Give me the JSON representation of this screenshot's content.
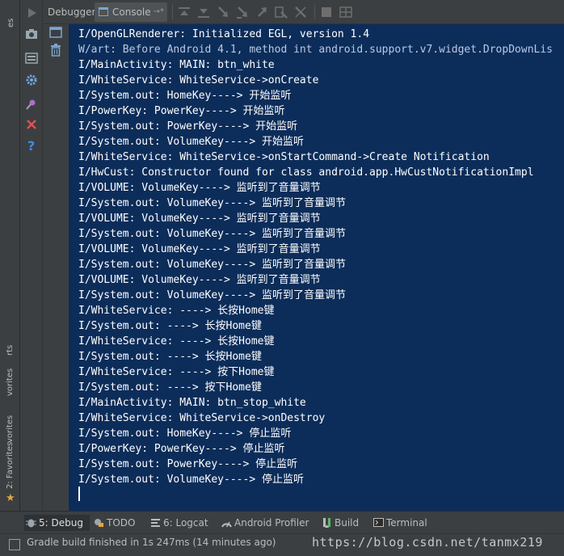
{
  "left_stripe": {
    "top_label": "es",
    "favorites_label": "2: Favorites",
    "favorites_cut": "vorites",
    "favorites_cut2": "vorites",
    "structure_cut": "rts"
  },
  "tabs": {
    "debugger": "Debugger",
    "console": "Console",
    "console_pin": "→*"
  },
  "console": {
    "lines": [
      {
        "text": "I/OpenGLRenderer: Initialized EGL, version 1.4",
        "level": "info"
      },
      {
        "text": "W/art: Before Android 4.1, method int android.support.v7.widget.DropDownLis",
        "level": "warn"
      },
      {
        "text": "I/MainActivity: MAIN: btn_white",
        "level": "info"
      },
      {
        "text": "I/WhiteService: WhiteService->onCreate",
        "level": "info"
      },
      {
        "text": "I/System.out: HomeKey----> 开始监听",
        "level": "info"
      },
      {
        "text": "I/PowerKey: PowerKey----> 开始监听",
        "level": "info"
      },
      {
        "text": "I/System.out: PowerKey----> 开始监听",
        "level": "info"
      },
      {
        "text": "I/System.out: VolumeKey----> 开始监听",
        "level": "info"
      },
      {
        "text": "I/WhiteService: WhiteService->onStartCommand->Create Notification",
        "level": "info"
      },
      {
        "text": "I/HwCust: Constructor found for class android.app.HwCustNotificationImpl",
        "level": "info"
      },
      {
        "text": "I/VOLUME: VolumeKey----> 监听到了音量调节",
        "level": "info"
      },
      {
        "text": "I/System.out: VolumeKey----> 监听到了音量调节",
        "level": "info"
      },
      {
        "text": "I/VOLUME: VolumeKey----> 监听到了音量调节",
        "level": "info"
      },
      {
        "text": "I/System.out: VolumeKey----> 监听到了音量调节",
        "level": "info"
      },
      {
        "text": "I/VOLUME: VolumeKey----> 监听到了音量调节",
        "level": "info"
      },
      {
        "text": "I/System.out: VolumeKey----> 监听到了音量调节",
        "level": "info"
      },
      {
        "text": "I/VOLUME: VolumeKey----> 监听到了音量调节",
        "level": "info"
      },
      {
        "text": "I/System.out: VolumeKey----> 监听到了音量调节",
        "level": "info"
      },
      {
        "text": "I/WhiteService: ----> 长按Home键",
        "level": "info"
      },
      {
        "text": "I/System.out: ----> 长按Home键",
        "level": "info"
      },
      {
        "text": "I/WhiteService: ----> 长按Home键",
        "level": "info"
      },
      {
        "text": "I/System.out: ----> 长按Home键",
        "level": "info"
      },
      {
        "text": "I/WhiteService: ----> 按下Home键",
        "level": "info"
      },
      {
        "text": "I/System.out: ----> 按下Home键",
        "level": "info"
      },
      {
        "text": "I/MainActivity: MAIN: btn_stop_white",
        "level": "info"
      },
      {
        "text": "I/WhiteService: WhiteService->onDestroy",
        "level": "info"
      },
      {
        "text": "I/System.out: HomeKey----> 停止监听",
        "level": "info"
      },
      {
        "text": "I/PowerKey: PowerKey----> 停止监听",
        "level": "info"
      },
      {
        "text": "I/System.out: PowerKey----> 停止监听",
        "level": "info"
      },
      {
        "text": "I/System.out: VolumeKey----> 停止监听",
        "level": "info"
      }
    ]
  },
  "bottom_tabs": [
    {
      "label": "5: Debug",
      "icon": "bug-icon",
      "active": true
    },
    {
      "label": "TODO",
      "icon": "todo-icon",
      "active": false
    },
    {
      "label": "6: Logcat",
      "icon": "logcat-icon",
      "active": false
    },
    {
      "label": "Android Profiler",
      "icon": "profiler-icon",
      "active": false
    },
    {
      "label": "Build",
      "icon": "build-icon",
      "active": false
    },
    {
      "label": "Terminal",
      "icon": "terminal-icon",
      "active": false
    }
  ],
  "status": {
    "message": "Gradle build finished in 1s 247ms (14 minutes ago)",
    "watermark": "https://blog.csdn.net/tanmx219"
  },
  "colors": {
    "console_bg": "#0c2d5a",
    "ide_bg": "#3c3f41",
    "favorites_star": "#e8a33d",
    "stop_red": "#e05252",
    "help_blue": "#3c8ee0"
  }
}
